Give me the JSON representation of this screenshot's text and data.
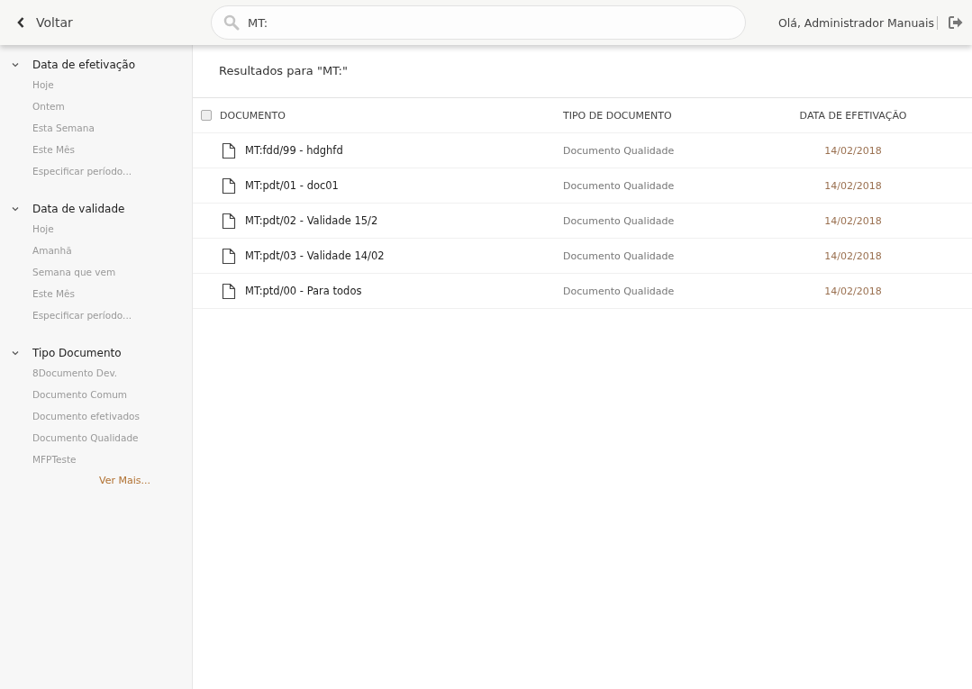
{
  "header": {
    "back": "Voltar",
    "search": {
      "value": "MT:"
    },
    "greeting": "Olá, Administrador Manuais"
  },
  "sidebar": {
    "groups": [
      {
        "title": "Data de efetivação",
        "expanded": true,
        "items": [
          "Hoje",
          "Ontem",
          "Esta Semana",
          "Este Mês",
          "Especificar período..."
        ]
      },
      {
        "title": "Data de validade",
        "expanded": true,
        "items": [
          "Hoje",
          "Amanhã",
          "Semana que vem",
          "Este Mês",
          "Especificar período..."
        ]
      },
      {
        "title": "Tipo Documento",
        "expanded": true,
        "items": [
          "8Documento Dev.",
          "Documento Comum",
          "Documento efetivados",
          "Documento Qualidade",
          "MFPTeste"
        ],
        "more": "Ver Mais..."
      }
    ]
  },
  "results": {
    "title": "Resultados para \"MT:\"",
    "table": {
      "select_all": {
        "checked": false
      },
      "columns": [
        "DOCUMENTO",
        "TIPO DE DOCUMENTO",
        "DATA DE EFETIVAÇÃO"
      ],
      "rows": [
        {
          "document": "MT:fdd/99 - hdghfd",
          "type": "Documento Qualidade",
          "date": "14/02/2018"
        },
        {
          "document": "MT:pdt/01 - doc01",
          "type": "Documento Qualidade",
          "date": "14/02/2018"
        },
        {
          "document": "MT:pdt/02 - Validade 15/2",
          "type": "Documento Qualidade",
          "date": "14/02/2018"
        },
        {
          "document": "MT:pdt/03 - Validade 14/02",
          "type": "Documento Qualidade",
          "date": "14/02/2018"
        },
        {
          "document": "MT:ptd/00 - Para todos",
          "type": "Documento Qualidade",
          "date": "14/02/2018"
        }
      ]
    }
  }
}
